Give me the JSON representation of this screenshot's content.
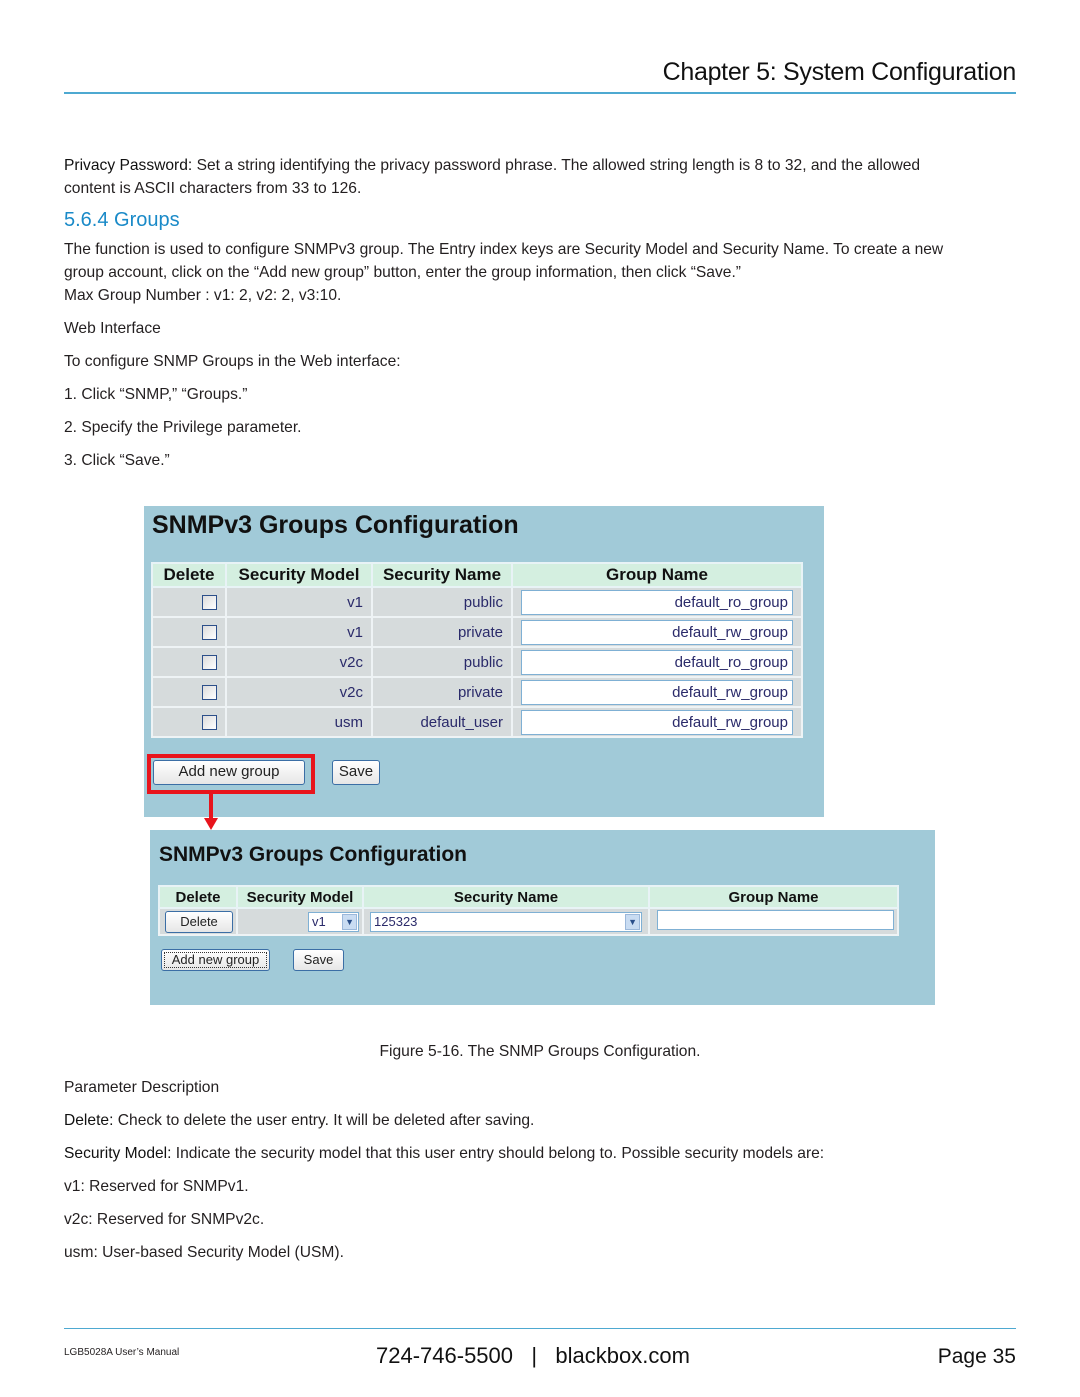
{
  "header": {
    "chapter_title": "Chapter 5: System Configuration"
  },
  "intro": {
    "privacy_label": "Privacy Password:",
    "privacy_text_1": " Set a string identifying the privacy password phrase. The allowed string length is 8 to 32, and the allowed",
    "privacy_text_2": "content is ASCII characters from 33 to 126."
  },
  "section": {
    "heading": "5.6.4 Groups",
    "desc_1": "The function is used to configure SNMPv3 group. The Entry index keys are Security Model and Security Name. To create a new",
    "desc_2": "group account, click on the “Add new group” button, enter the group information, then click “Save.”",
    "desc_3": "Max Group Number : v1: 2, v2: 2, v3:10.",
    "web_interface_heading": "Web Interface",
    "web_interface_intro": "To configure SNMP Groups in the Web interface:",
    "steps": [
      "1. Click “SNMP,” “Groups.”",
      "2. Specify the Privilege parameter.",
      "3. Click “Save.”"
    ]
  },
  "figure1": {
    "title": "SNMPv3 Groups Configuration",
    "columns": [
      "Delete",
      "Security Model",
      "Security Name",
      "Group Name"
    ],
    "rows": [
      {
        "delete": false,
        "model": "v1",
        "name": "public",
        "group": "default_ro_group"
      },
      {
        "delete": false,
        "model": "v1",
        "name": "private",
        "group": "default_rw_group"
      },
      {
        "delete": false,
        "model": "v2c",
        "name": "public",
        "group": "default_ro_group"
      },
      {
        "delete": false,
        "model": "v2c",
        "name": "private",
        "group": "default_rw_group"
      },
      {
        "delete": false,
        "model": "usm",
        "name": "default_user",
        "group": "default_rw_group"
      }
    ],
    "add_button": "Add new group",
    "save_button": "Save",
    "highlight_color": "#e8141c"
  },
  "figure2": {
    "title": "SNMPv3 Groups Configuration",
    "columns": [
      "Delete",
      "Security Model",
      "Security Name",
      "Group Name"
    ],
    "row": {
      "delete_button": "Delete",
      "model_selected": "v1",
      "name_selected": "125323",
      "group_value": ""
    },
    "add_button": "Add new group",
    "save_button": "Save"
  },
  "caption": "Figure 5-16. The SNMP Groups Configuration.",
  "params": {
    "heading": "Parameter Description",
    "delete_label": "Delete:",
    "delete_text": " Check to delete the user entry. It will be deleted after saving.",
    "model_label": "Security Model:",
    "model_text": " Indicate the security model that this user entry should belong to. Possible security models are:",
    "models": [
      "v1: Reserved for SNMPv1.",
      "v2c: Reserved for SNMPv2c.",
      "usm: User-based Security Model (USM)."
    ]
  },
  "footer": {
    "manual": "LGB5028A User’s Manual",
    "contact": "724-746-5500   |   blackbox.com",
    "page": "Page 35"
  },
  "colors": {
    "accent": "#1a8ac8",
    "rule": "#4ea9d1",
    "panel_bg": "#a1cad8",
    "header_bg": "#d4efe0"
  }
}
